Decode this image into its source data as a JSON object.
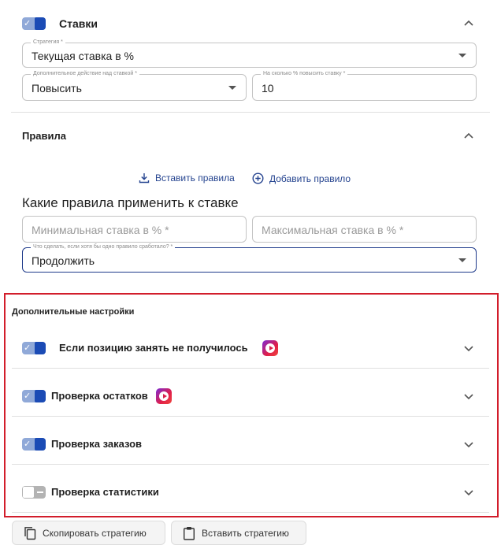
{
  "bids": {
    "title": "Ставки",
    "enabled": true,
    "strategy": {
      "label": "Стратегия *",
      "value": "Текущая ставка в %"
    },
    "action": {
      "label": "Дополнительное действие над ставкой *",
      "value": "Повысить"
    },
    "percent": {
      "label": "На сколько % повысить ставку *",
      "value": "10"
    }
  },
  "rules": {
    "title": "Правила",
    "paste_label": "Вставить правила",
    "add_label": "Добавить правило",
    "heading": "Какие правила применить к ставке",
    "min_placeholder": "Минимальная ставка в % *",
    "max_placeholder": "Максимальная ставка в % *",
    "if_any": {
      "label": "Что сделать, если хотя бы одно правило сработало? *",
      "value": "Продолжить"
    }
  },
  "extra": {
    "title": "Дополнительные настройки",
    "items": [
      {
        "label": "Если позицию занять не получилось",
        "enabled": true,
        "badge": "rutube-icon"
      },
      {
        "label": "Проверка остатков",
        "enabled": true,
        "badge": "rutube-icon"
      },
      {
        "label": "Проверка заказов",
        "enabled": true
      },
      {
        "label": "Проверка статистики",
        "enabled": false
      }
    ]
  },
  "footer": {
    "copy_label": "Скопировать стратегию",
    "paste_label": "Вставить стратегию"
  },
  "colors": {
    "accent": "#1b4bb5",
    "highlight": "#d21d2b",
    "link": "#24438f"
  }
}
